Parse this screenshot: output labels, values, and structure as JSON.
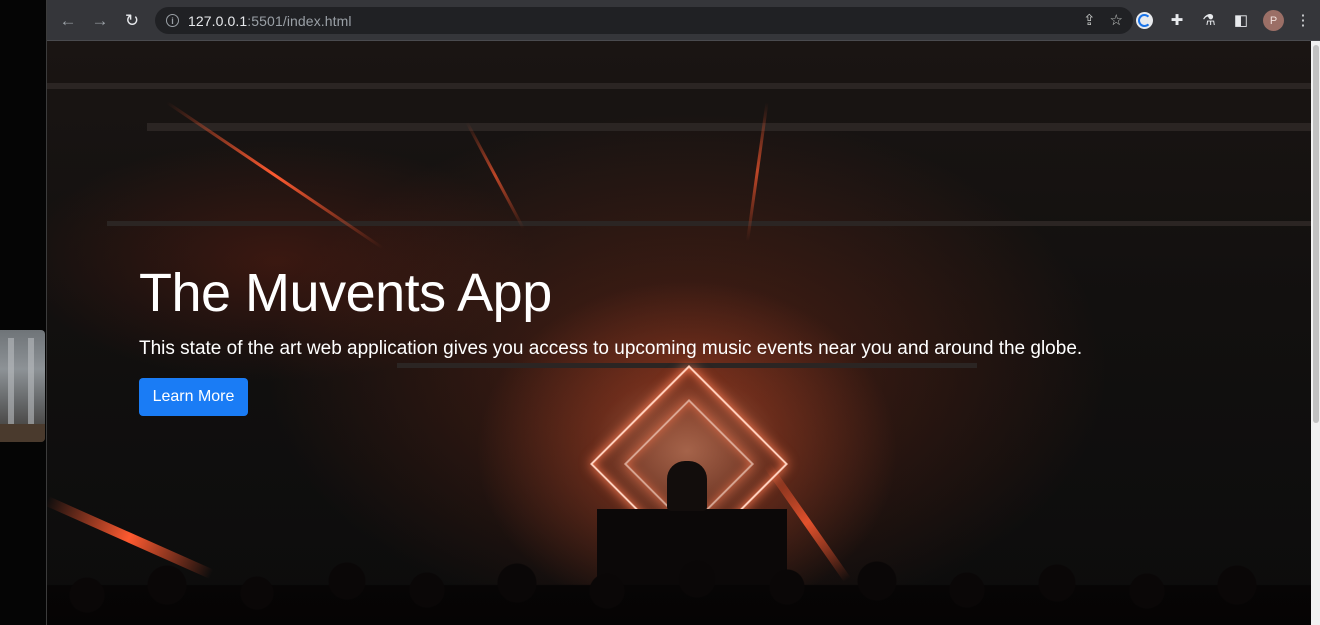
{
  "browser": {
    "back_icon": "arrow-left-icon",
    "forward_icon": "arrow-right-icon",
    "reload_icon": "reload-icon",
    "url_host": "127.0.0.1",
    "url_rest": ":5501/index.html",
    "profile_initial": "P",
    "accent": "#1a73e8"
  },
  "hero": {
    "title": "The Muvents App",
    "subtitle": "This state of the art web application gives you access to upcoming music events near you and around the globe.",
    "cta_label": "Learn More",
    "cta_color": "#1a7cf5"
  }
}
